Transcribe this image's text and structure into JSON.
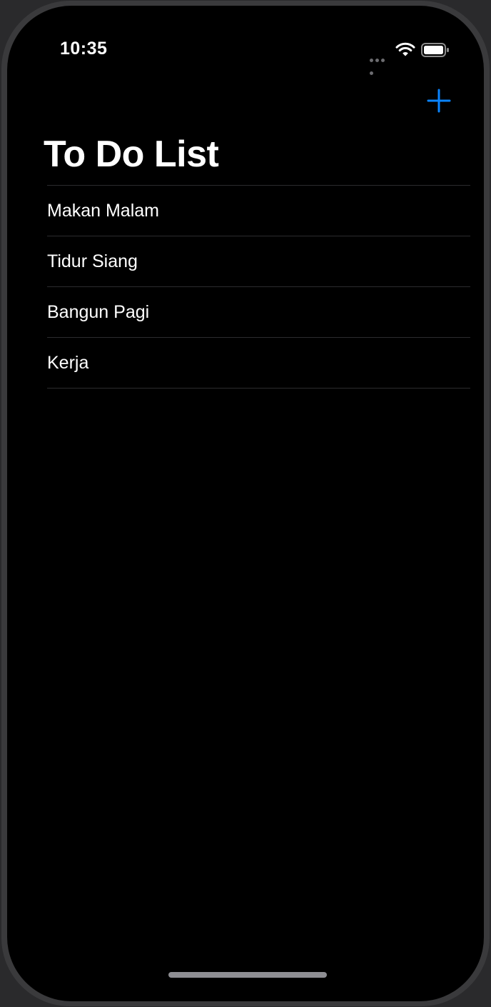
{
  "status_bar": {
    "time": "10:35"
  },
  "nav": {
    "title": "To Do List",
    "add_icon": "plus-icon",
    "accent_color": "#0a84ff"
  },
  "todos": [
    {
      "label": "Makan Malam"
    },
    {
      "label": "Tidur Siang"
    },
    {
      "label": "Bangun Pagi"
    },
    {
      "label": "Kerja"
    }
  ]
}
